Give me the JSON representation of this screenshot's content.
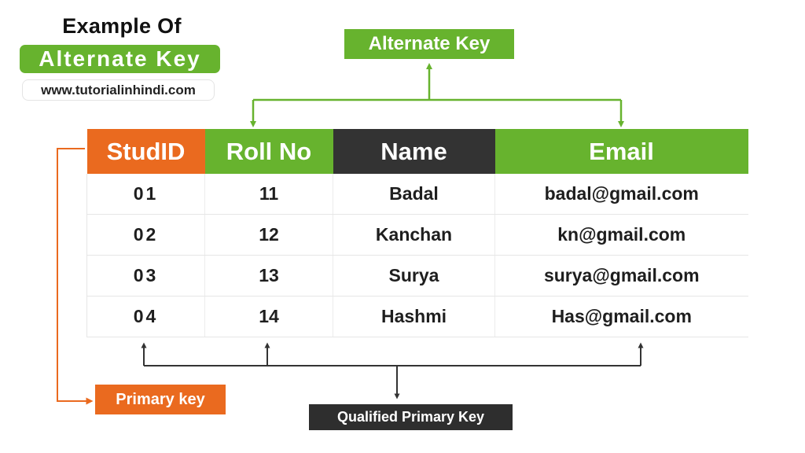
{
  "header": {
    "title_line1": "Example Of",
    "title_line2": "Alternate Key",
    "website": "www.tutorialinhindi.com"
  },
  "labels": {
    "alternate_key": "Alternate Key",
    "primary_key": "Primary key",
    "qualified_primary_key": "Qualified Primary Key"
  },
  "colors": {
    "green": "#67b32e",
    "orange": "#ea6a1f",
    "dark": "#333333"
  },
  "table": {
    "columns": [
      {
        "label": "StudID",
        "role": "primary-key"
      },
      {
        "label": "Roll No",
        "role": "alternate-key"
      },
      {
        "label": "Name",
        "role": "non-key"
      },
      {
        "label": "Email",
        "role": "alternate-key"
      }
    ],
    "rows": [
      [
        "01",
        "11",
        "Badal",
        "badal@gmail.com"
      ],
      [
        "02",
        "12",
        "Kanchan",
        "kn@gmail.com"
      ],
      [
        "03",
        "13",
        "Surya",
        "surya@gmail.com"
      ],
      [
        "04",
        "14",
        "Hashmi",
        "Has@gmail.com"
      ]
    ]
  }
}
